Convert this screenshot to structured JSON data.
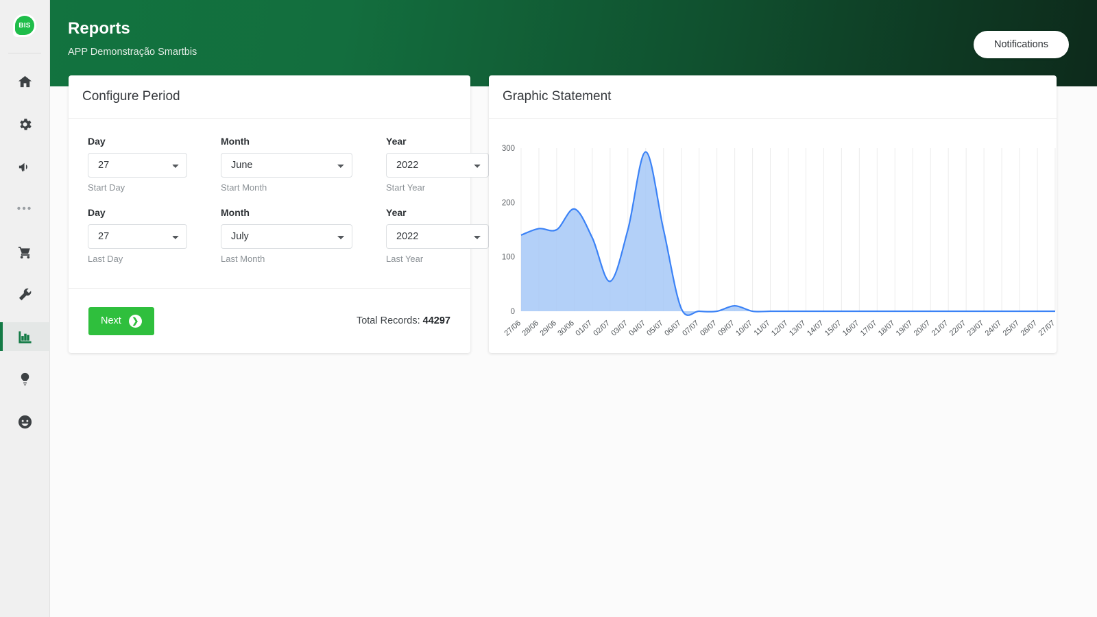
{
  "brand": {
    "logo_text": "BIS",
    "logo_icon": "speech-bubble-logo",
    "accent_green": "#137a45",
    "button_green": "#2fbf3d"
  },
  "sidebar": {
    "items": [
      {
        "icon": "home-icon",
        "name": "home",
        "active": false
      },
      {
        "icon": "gear-icon",
        "name": "settings",
        "active": false
      },
      {
        "icon": "megaphone-icon",
        "name": "campaigns",
        "active": false
      },
      {
        "icon": "ellipsis-icon",
        "name": "more",
        "active": false
      },
      {
        "icon": "shopping-cart-icon",
        "name": "orders",
        "active": false
      },
      {
        "icon": "wrench-icon",
        "name": "tools",
        "active": false
      },
      {
        "icon": "bar-chart-icon",
        "name": "reports",
        "active": true
      },
      {
        "icon": "lightbulb-icon",
        "name": "ideas",
        "active": false
      },
      {
        "icon": "smiley-icon",
        "name": "feedback",
        "active": false
      }
    ]
  },
  "header": {
    "title": "Reports",
    "subtitle": "APP Demonstração Smartbis",
    "notifications_label": "Notifications"
  },
  "period_card": {
    "title": "Configure Period",
    "fields": [
      {
        "label": "Day",
        "value": "27",
        "help": "Start Day"
      },
      {
        "label": "Month",
        "value": "June",
        "help": "Start Month"
      },
      {
        "label": "Year",
        "value": "2022",
        "help": "Start Year"
      },
      {
        "label": "Day",
        "value": "27",
        "help": "Last Day"
      },
      {
        "label": "Month",
        "value": "July",
        "help": "Last Month"
      },
      {
        "label": "Year",
        "value": "2022",
        "help": "Last Year"
      }
    ],
    "next_label": "Next",
    "next_icon": "arrow-right-circle-icon",
    "total_records_label": "Total Records:",
    "total_records_value": "44297"
  },
  "chart_card": {
    "title": "Graphic Statement"
  },
  "chart_data": {
    "type": "area",
    "title": "Graphic Statement",
    "xlabel": "",
    "ylabel": "",
    "ylim": [
      0,
      300
    ],
    "yticks": [
      0,
      100,
      200,
      300
    ],
    "grid": true,
    "legend": "none",
    "line_color": "#3b82f6",
    "fill_color": "#a6c8f7",
    "categories": [
      "27/06",
      "28/06",
      "29/06",
      "30/06",
      "01/07",
      "02/07",
      "03/07",
      "04/07",
      "05/07",
      "06/07",
      "07/07",
      "08/07",
      "09/07",
      "10/07",
      "11/07",
      "12/07",
      "13/07",
      "14/07",
      "15/07",
      "16/07",
      "17/07",
      "18/07",
      "19/07",
      "20/07",
      "21/07",
      "22/07",
      "23/07",
      "24/07",
      "25/07",
      "26/07",
      "27/07"
    ],
    "values": [
      140,
      152,
      150,
      188,
      135,
      55,
      150,
      293,
      150,
      5,
      0,
      0,
      10,
      0,
      0,
      0,
      0,
      0,
      0,
      0,
      0,
      0,
      0,
      0,
      0,
      0,
      0,
      0,
      0,
      0,
      0
    ]
  }
}
